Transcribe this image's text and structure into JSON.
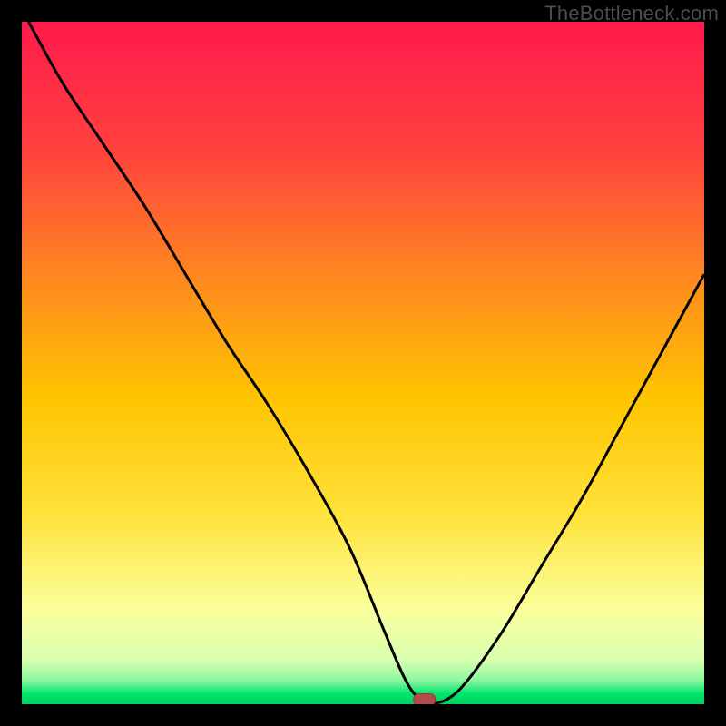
{
  "watermark": "TheBottleneck.com",
  "colors": {
    "frame": "#000000",
    "top": "#ff1a4b",
    "mid": "#ffd400",
    "pale": "#ffffa8",
    "green": "#00e46a",
    "curve": "#000000",
    "marker_fill": "#b6494e",
    "marker_stroke": "#8e3a3e"
  },
  "chart_data": {
    "type": "line",
    "title": "",
    "xlabel": "",
    "ylabel": "",
    "xlim": [
      0,
      100
    ],
    "ylim": [
      0,
      100
    ],
    "grid": false,
    "legend": false,
    "series": [
      {
        "name": "bottleneck-curve",
        "x": [
          1,
          6,
          12,
          18,
          24,
          30,
          36,
          42,
          48,
          53,
          56,
          58,
          60,
          64,
          70,
          76,
          82,
          88,
          94,
          100
        ],
        "y": [
          100,
          91,
          82,
          73,
          63,
          53,
          44,
          34,
          23,
          11,
          4,
          1,
          0,
          2,
          10,
          20,
          30,
          41,
          52,
          63
        ]
      }
    ],
    "marker": {
      "x": 59,
      "y": 0.6
    },
    "gradient_stops": [
      {
        "offset": 0.0,
        "color": "#ff1a4b"
      },
      {
        "offset": 0.18,
        "color": "#ff3f3f"
      },
      {
        "offset": 0.38,
        "color": "#ff8a1f"
      },
      {
        "offset": 0.55,
        "color": "#ffc400"
      },
      {
        "offset": 0.72,
        "color": "#ffe23a"
      },
      {
        "offset": 0.86,
        "color": "#fbff9a"
      },
      {
        "offset": 0.935,
        "color": "#d9ffb0"
      },
      {
        "offset": 0.965,
        "color": "#8cf7a0"
      },
      {
        "offset": 0.985,
        "color": "#00e46a"
      },
      {
        "offset": 1.0,
        "color": "#00d060"
      }
    ]
  }
}
